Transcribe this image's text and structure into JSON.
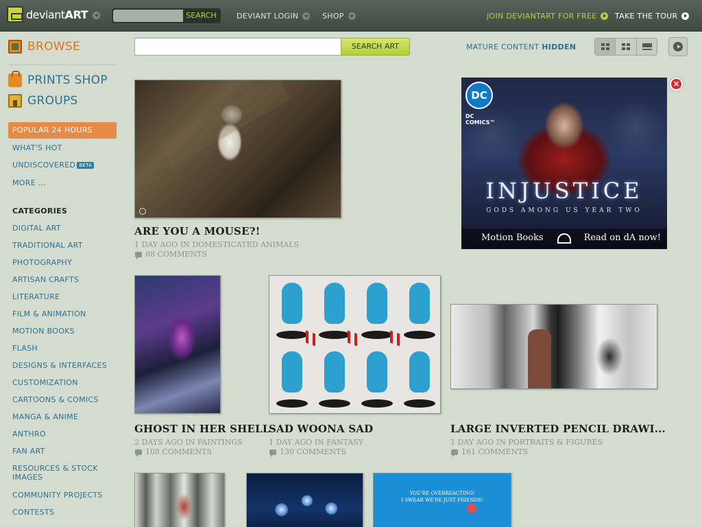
{
  "topbar": {
    "logo_text_a": "deviant",
    "logo_text_b": "ART",
    "search_button": "SEARCH",
    "deviant_login": "DEVIANT LOGIN",
    "shop": "SHOP",
    "join": "JOIN DEVIANTART FOR FREE",
    "tour": "TAKE THE TOUR",
    "accent_color": "#b7cf3a"
  },
  "sidebar": {
    "browse": "BROWSE",
    "prints_shop": "PRINTS SHOP",
    "groups": "GROUPS",
    "popular": "POPULAR 24 HOURS",
    "whats_hot": "WHAT'S HOT",
    "undiscovered": "UNDISCOVERED",
    "beta": "BETA",
    "more": "MORE ...",
    "categories_heading": "CATEGORIES",
    "categories": [
      "DIGITAL ART",
      "TRADITIONAL ART",
      "PHOTOGRAPHY",
      "ARTISAN CRAFTS",
      "LITERATURE",
      "FILM & ANIMATION",
      "MOTION BOOKS",
      "FLASH",
      "DESIGNS & INTERFACES",
      "CUSTOMIZATION",
      "CARTOONS & COMICS",
      "MANGA & ANIME",
      "ANTHRO",
      "FAN ART",
      "RESOURCES & STOCK IMAGES",
      "COMMUNITY PROJECTS",
      "CONTESTS"
    ],
    "active_color": "#e58a47",
    "link_color": "#2f6f8f"
  },
  "main": {
    "search_button": "SEARCH ART",
    "mature_label": "MATURE CONTENT",
    "mature_value": "HIDDEN",
    "deviations": [
      {
        "title": "ARE YOU A MOUSE?!",
        "meta": "1 DAY AGO IN DOMESTICATED ANIMALS",
        "comments": "88 COMMENTS"
      },
      {
        "title": "GHOST IN HER SHELL",
        "meta": "2 DAYS AGO IN PAINTINGS",
        "comments": "108 COMMENTS"
      },
      {
        "title": "SAD WOONA SAD",
        "meta": "1 DAY AGO IN FANTASY",
        "comments": "130 COMMENTS"
      },
      {
        "title": "LARGE INVERTED PENCIL DRAWI...",
        "meta": "1 DAY AGO IN PORTRAITS & FIGURES",
        "comments": "161 COMMENTS"
      }
    ],
    "row3_caption_line1": "YOU'RE OVERREACTING!",
    "row3_caption_line2": "I SWEAR WE'RE JUST FRIENDS!"
  },
  "ad": {
    "brand_logo": "DC",
    "brand_sub": "DC COMICS™",
    "title": "INJUSTICE",
    "subtitle": "GODS AMONG US YEAR TWO",
    "left_text": "Motion Books",
    "right_text": "Read on dA now!"
  }
}
